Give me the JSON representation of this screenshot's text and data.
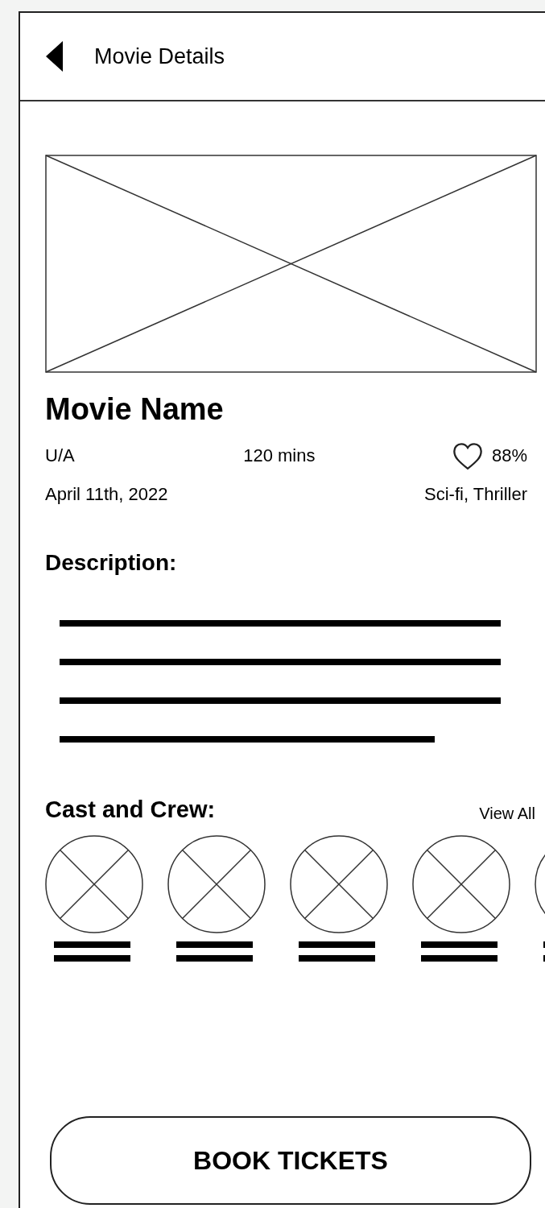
{
  "header": {
    "title": "Movie Details"
  },
  "movie": {
    "name": "Movie Name",
    "rating": "U/A",
    "duration": "120 mins",
    "score": "88%",
    "release_date": "April 11th, 2022",
    "genres": "Sci-fi, Thriller"
  },
  "description": {
    "heading": "Description:"
  },
  "cast": {
    "heading": "Cast and Crew:",
    "view_all": "View All"
  },
  "book_button": {
    "label": "BOOK TICKETS"
  }
}
